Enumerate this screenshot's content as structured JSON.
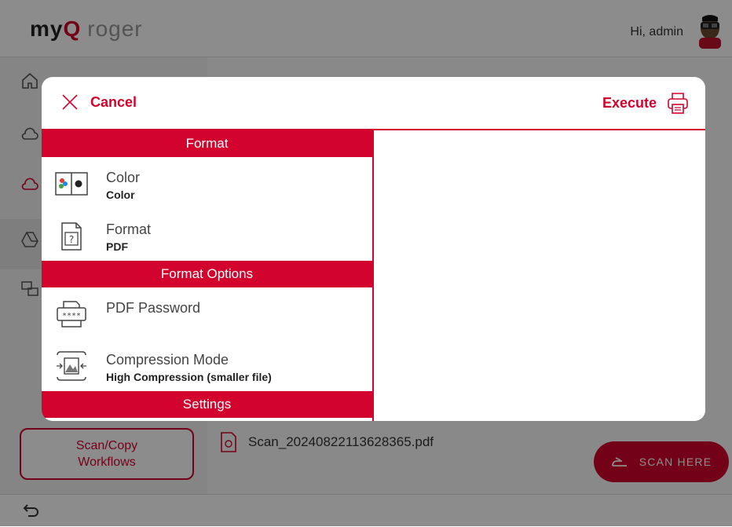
{
  "app": {
    "logo": {
      "part1": "my",
      "part2": "Q",
      "part3": "roger"
    },
    "greeting": "Hi, admin",
    "workflows_button": {
      "line1": "Scan/Copy",
      "line2": "Workflows"
    },
    "file_name": "Scan_20240822113628365.pdf",
    "scan_button": "SCAN HERE"
  },
  "modal": {
    "cancel_label": "Cancel",
    "execute_label": "Execute",
    "sections": [
      {
        "title": "Format",
        "options": [
          {
            "title": "Color",
            "value": "Color",
            "icon": "color-mode-icon"
          },
          {
            "title": "Format",
            "value": "PDF",
            "icon": "file-format-icon"
          }
        ]
      },
      {
        "title": "Format Options",
        "options": [
          {
            "title": "PDF Password",
            "value": "",
            "icon": "password-icon"
          },
          {
            "title": "Compression Mode",
            "value": "High Compression (smaller file)",
            "icon": "compression-icon"
          }
        ]
      },
      {
        "title": "Settings",
        "options": []
      }
    ]
  },
  "colors": {
    "accent": "#d2042d",
    "overlay": "rgba(0,0,0,0.45)"
  }
}
